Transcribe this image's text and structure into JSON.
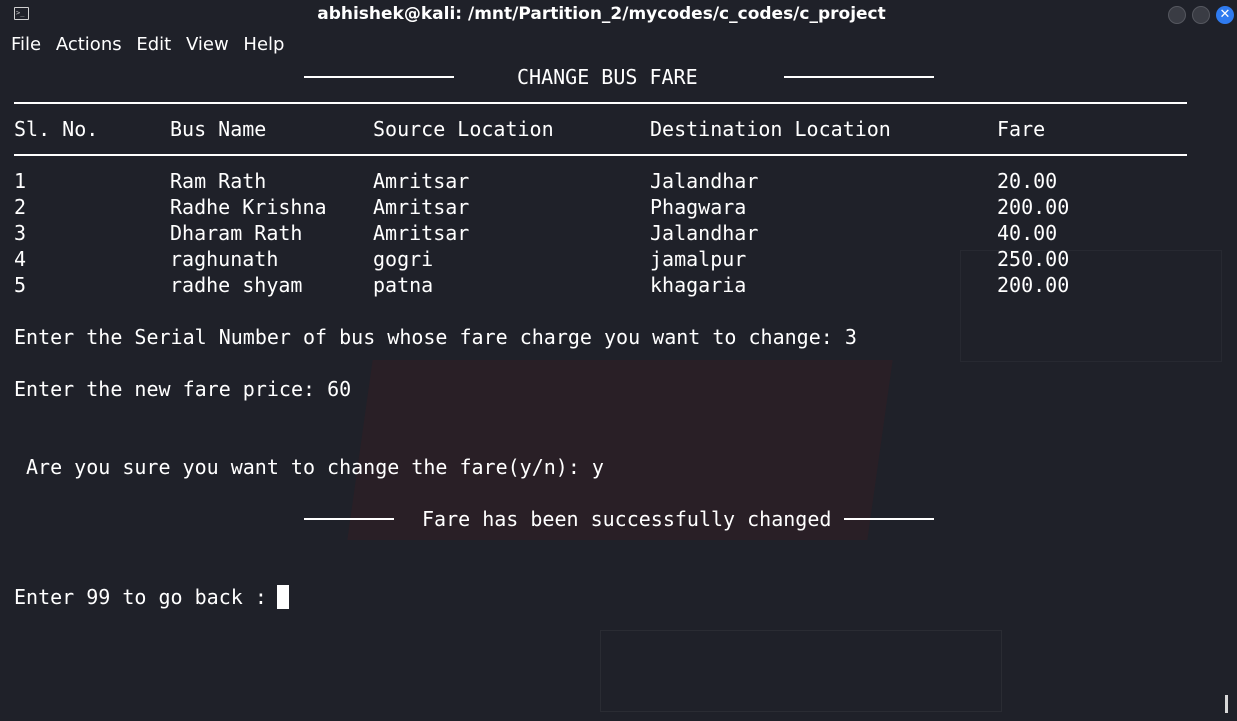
{
  "window": {
    "title": "abhishek@kali: /mnt/Partition_2/mycodes/c_codes/c_project",
    "terminal_icon": "terminal-icon",
    "close_glyph": "✕"
  },
  "menu": [
    "File",
    "Actions",
    "Edit",
    "View",
    "Help"
  ],
  "screen": {
    "heading": "CHANGE BUS FARE",
    "columns": [
      "Sl. No.",
      "Bus Name",
      "Source Location",
      "Destination Location",
      "Fare"
    ],
    "rows": [
      [
        "1",
        "Ram Rath",
        "Amritsar",
        "Jalandhar",
        "20.00"
      ],
      [
        "2",
        "Radhe Krishna",
        "Amritsar",
        "Phagwara",
        "200.00"
      ],
      [
        "3",
        "Dharam Rath",
        "Amritsar",
        "Jalandhar",
        "40.00"
      ],
      [
        "4",
        "raghunath",
        "gogri",
        "jamalpur",
        "250.00"
      ],
      [
        "5",
        "radhe shyam",
        "patna",
        "khagaria",
        "200.00"
      ]
    ],
    "prompt_serial": "Enter the Serial Number of bus whose fare charge you want to change: 3",
    "prompt_fare": "Enter the new fare price: 60",
    "prompt_confirm": "Are you sure you want to change the fare(y/n): y",
    "success": "Fare has been successfully changed",
    "prompt_back": "Enter 99 to go back :"
  },
  "colors": {
    "background": "#1f2129",
    "text": "#ffffff",
    "close_button": "#2f7bf0"
  }
}
